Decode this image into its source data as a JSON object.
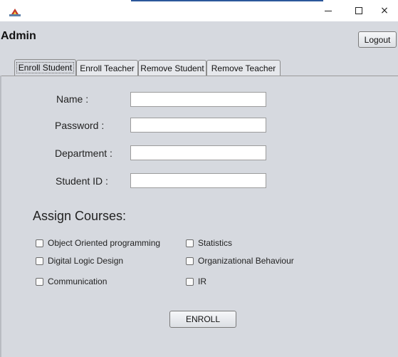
{
  "window": {
    "minimize_glyph": "",
    "close_glyph": "×"
  },
  "header": {
    "title": "Admin",
    "logout_label": "Logout"
  },
  "tabs": [
    {
      "label": "Enroll Student",
      "active": true
    },
    {
      "label": "Enroll Teacher",
      "active": false
    },
    {
      "label": "Remove Student",
      "active": false
    },
    {
      "label": "Remove Teacher",
      "active": false
    }
  ],
  "form": {
    "name_label": "Name :",
    "name_value": "",
    "password_label": "Password :",
    "password_value": "",
    "department_label": "Department :",
    "department_value": "",
    "student_id_label": "Student ID :",
    "student_id_value": ""
  },
  "courses": {
    "title": "Assign Courses:",
    "items": [
      {
        "label": "Object Oriented programming",
        "checked": false
      },
      {
        "label": "Statistics",
        "checked": false
      },
      {
        "label": "Digital Logic Design",
        "checked": false
      },
      {
        "label": "Organizational Behaviour",
        "checked": false
      },
      {
        "label": "Communication",
        "checked": false
      },
      {
        "label": "IR",
        "checked": false
      }
    ]
  },
  "enroll_label": "ENROLL"
}
